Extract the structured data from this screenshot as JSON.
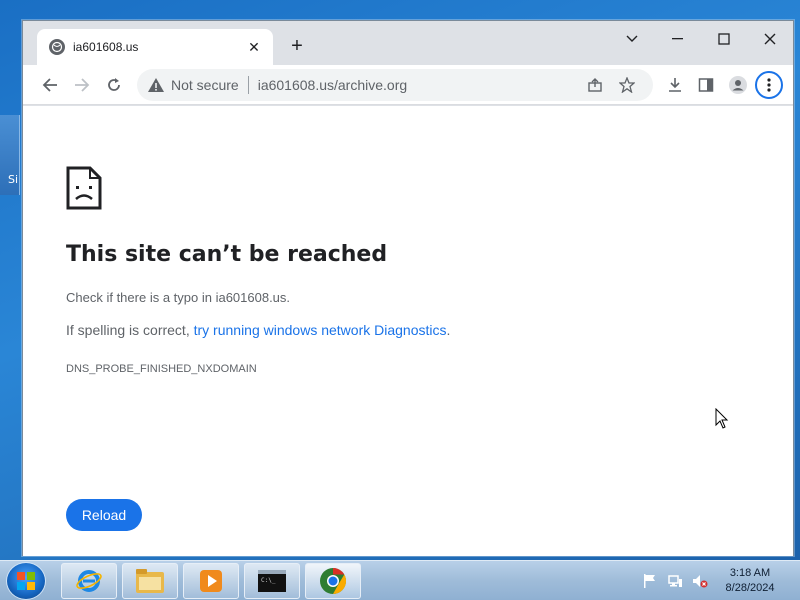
{
  "desktop": {
    "edge_label": "Si"
  },
  "browser": {
    "tab": {
      "title": "ia601608.us"
    },
    "newtab": "+",
    "omnibox": {
      "security_label": "Not secure",
      "url": "ia601608.us/archive.org"
    }
  },
  "error": {
    "title": "This site can’t be reached",
    "line1": "Check if there is a typo in ia601608.us.",
    "line2_prefix": "If spelling is correct, ",
    "line2_link": "try running windows network Diagnostics",
    "line2_suffix": ".",
    "code": "DNS_PROBE_FINISHED_NXDOMAIN",
    "reload_label": "Reload"
  },
  "taskbar": {
    "apps": [
      "internet-explorer",
      "file-explorer",
      "media-player",
      "command-prompt",
      "chrome"
    ],
    "active_app": "chrome",
    "cmd_label": "C:\\_",
    "clock_time": "3:18 AM",
    "clock_date": "8/28/2024"
  },
  "colors": {
    "accent": "#1a73e8",
    "text": "#202124",
    "muted": "#5f6368"
  }
}
